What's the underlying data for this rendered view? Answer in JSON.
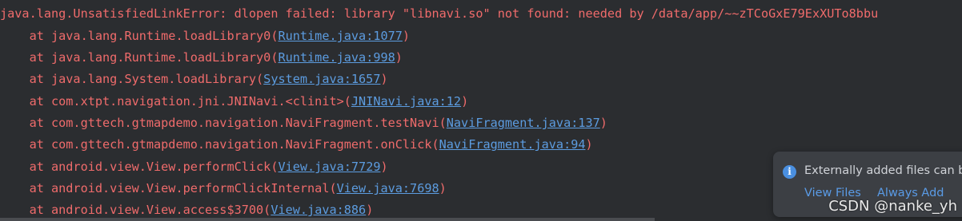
{
  "console": {
    "lines": [
      {
        "prefix": "java.lang.UnsatisfiedLinkError: dlopen failed: library \"libnavi.so\" not found: needed by /data/app/~~zTCoGxE79ExXUTo8bbu",
        "link": "",
        "suffix": ""
      },
      {
        "prefix": "    at java.lang.Runtime.loadLibrary0(",
        "link": "Runtime.java:1077",
        "suffix": ")"
      },
      {
        "prefix": "    at java.lang.Runtime.loadLibrary0(",
        "link": "Runtime.java:998",
        "suffix": ")"
      },
      {
        "prefix": "    at java.lang.System.loadLibrary(",
        "link": "System.java:1657",
        "suffix": ")"
      },
      {
        "prefix": "    at com.xtpt.navigation.jni.JNINavi.<clinit>(",
        "link": "JNINavi.java:12",
        "suffix": ")"
      },
      {
        "prefix": "    at com.gttech.gtmapdemo.navigation.NaviFragment.testNavi(",
        "link": "NaviFragment.java:137",
        "suffix": ")"
      },
      {
        "prefix": "    at com.gttech.gtmapdemo.navigation.NaviFragment.onClick(",
        "link": "NaviFragment.java:94",
        "suffix": ")"
      },
      {
        "prefix": "    at android.view.View.performClick(",
        "link": "View.java:7729",
        "suffix": ")"
      },
      {
        "prefix": "    at android.view.View.performClickInternal(",
        "link": "View.java:7698",
        "suffix": ")"
      },
      {
        "prefix": "    at android.view.View.access$3700(",
        "link": "View.java:886",
        "suffix": ")"
      }
    ]
  },
  "notification": {
    "icon": "info-icon",
    "message": "Externally added files can b",
    "actions": [
      "View Files",
      "Always Add"
    ]
  },
  "watermark": "CSDN @nanke_yh",
  "colors": {
    "background": "#2b2d30",
    "error_text": "#ef6b6b",
    "link": "#5c9ce0",
    "notification_bg": "#3c3f44"
  }
}
